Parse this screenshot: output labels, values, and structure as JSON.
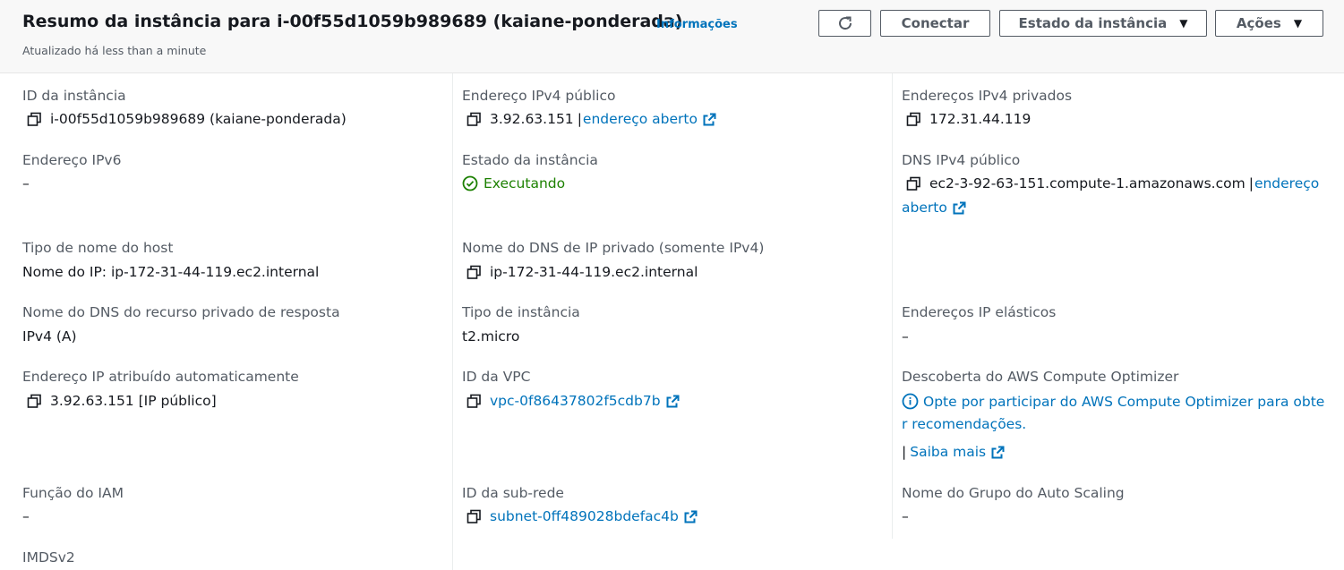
{
  "header": {
    "title": "Resumo da instância para i-00f55d1059b989689 (kaiane-ponderada)",
    "info_link": "Informações",
    "subtitle": "Atualizado há less than a minute",
    "connect_label": "Conectar",
    "state_menu_label": "Estado da instância",
    "actions_label": "Ações"
  },
  "colors": {
    "link": "#0073bb",
    "running": "#1d8102",
    "label": "#545b64"
  },
  "fields": {
    "instance_id": {
      "label": "ID da instância",
      "value": "i-00f55d1059b989689 (kaiane-ponderada)"
    },
    "public_ipv4": {
      "label": "Endereço IPv4 público",
      "value": "3.92.63.151",
      "link": "endereço aberto"
    },
    "private_ipv4": {
      "label": "Endereços IPv4 privados",
      "value": "172.31.44.119"
    },
    "ipv6": {
      "label": "Endereço IPv6",
      "value": "–"
    },
    "state": {
      "label": "Estado da instância",
      "value": "Executando"
    },
    "public_dns": {
      "label": "DNS IPv4 público",
      "value": "ec2-3-92-63-151.compute-1.amazonaws.com",
      "link_part1": "endereço",
      "link_part2": "aberto"
    },
    "hostname_type": {
      "label": "Tipo de nome do host",
      "value": "Nome do IP: ip-172-31-44-119.ec2.internal"
    },
    "private_dns": {
      "label": "Nome do DNS de IP privado (somente IPv4)",
      "value": "ip-172-31-44-119.ec2.internal"
    },
    "answer_dns": {
      "label": "Nome do DNS do recurso privado de resposta",
      "value": "IPv4 (A)"
    },
    "instance_type": {
      "label": "Tipo de instância",
      "value": "t2.micro"
    },
    "elastic_ips": {
      "label": "Endereços IP elásticos",
      "value": "–"
    },
    "auto_ip": {
      "label": "Endereço IP atribuído automaticamente",
      "value": "3.92.63.151 [IP público]"
    },
    "vpc": {
      "label": "ID da VPC",
      "value": "vpc-0f86437802f5cdb7b"
    },
    "optimizer": {
      "label": "Descoberta do AWS Compute Optimizer",
      "line1": "Opte por participar do AWS Compute Optimizer para obte",
      "line2": "r recomendações.",
      "learn_more": "Saiba mais"
    },
    "iam_role": {
      "label": "Função do IAM",
      "value": "–"
    },
    "subnet": {
      "label": "ID da sub-rede",
      "value": "subnet-0ff489028bdefac4b"
    },
    "asg": {
      "label": "Nome do Grupo do Auto Scaling",
      "value": "–"
    },
    "imds": {
      "label": "IMDSv2"
    }
  }
}
